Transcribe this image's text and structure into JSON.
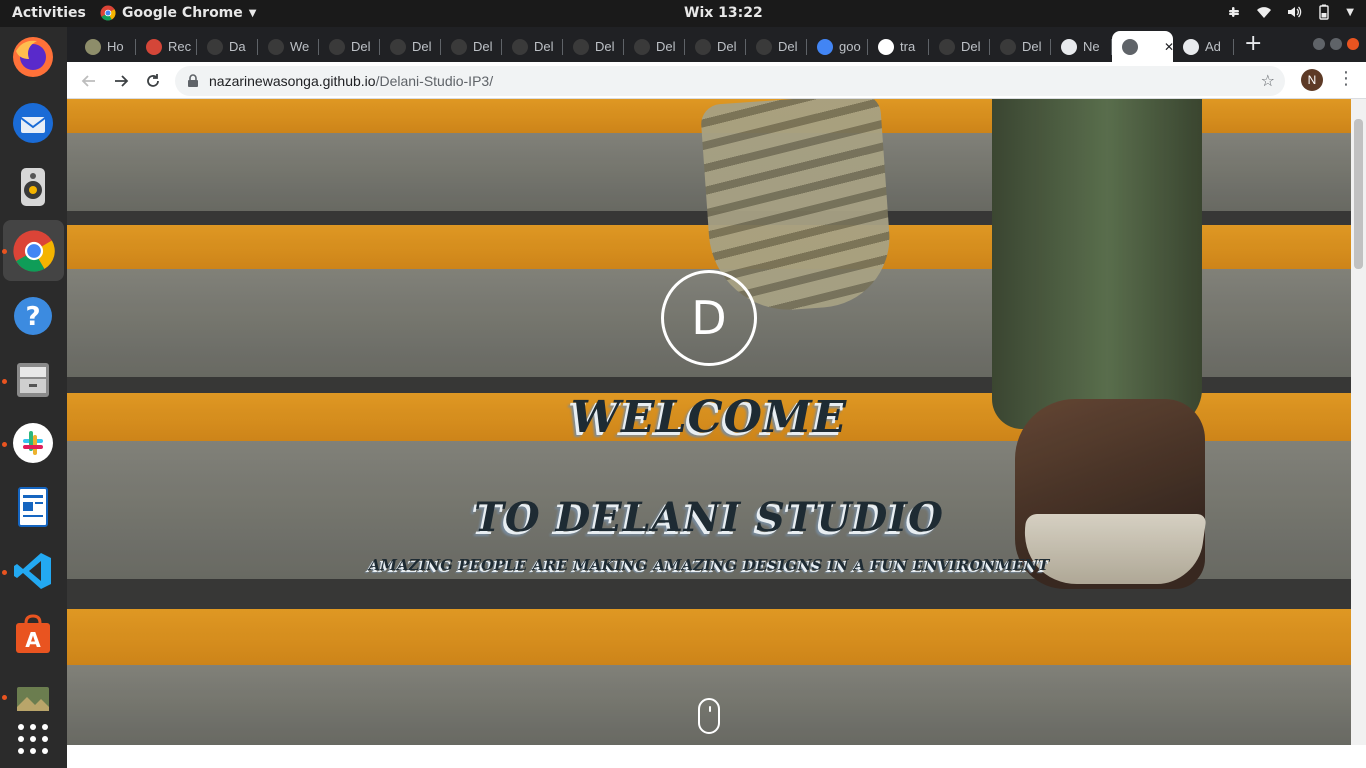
{
  "system": {
    "activities": "Activities",
    "app_menu": "Google Chrome",
    "clock": "Wix 13:22"
  },
  "dock": {
    "items": [
      "firefox-icon",
      "thunderbird-icon",
      "rhythmbox-icon",
      "chrome-icon",
      "help-icon",
      "files-icon",
      "slack-icon",
      "writer-icon",
      "vscode-icon",
      "software-icon",
      "image-viewer-icon",
      "app-grid-icon"
    ]
  },
  "browser": {
    "tabs": [
      {
        "label": "Ho",
        "favicon": "#8d8d6a"
      },
      {
        "label": "Rec",
        "favicon": "#d44638"
      },
      {
        "label": "Da",
        "favicon": "#3a3a3a"
      },
      {
        "label": "We",
        "favicon": "#3a3a3a"
      },
      {
        "label": "Del",
        "favicon": "#3a3a3a"
      },
      {
        "label": "Del",
        "favicon": "#3a3a3a"
      },
      {
        "label": "Del",
        "favicon": "#3a3a3a"
      },
      {
        "label": "Del",
        "favicon": "#3a3a3a"
      },
      {
        "label": "Del",
        "favicon": "#3a3a3a"
      },
      {
        "label": "Del",
        "favicon": "#3a3a3a"
      },
      {
        "label": "Del",
        "favicon": "#3a3a3a"
      },
      {
        "label": "Del",
        "favicon": "#3a3a3a"
      },
      {
        "label": "goo",
        "favicon": "#4285f4"
      },
      {
        "label": "tra",
        "favicon": "#ffffff"
      },
      {
        "label": "Del",
        "favicon": "#3a3a3a"
      },
      {
        "label": "Del",
        "favicon": "#3a3a3a"
      },
      {
        "label": "Ne",
        "favicon": "#e8eaed"
      },
      {
        "label": "",
        "favicon": "#5f6368"
      },
      {
        "label": "Ad",
        "favicon": "#e8eaed"
      }
    ],
    "active_tab_close": "✕",
    "new_tab": "+",
    "url_host": "nazarinewasonga.github.io",
    "url_path": "/Delani-Studio-IP3/",
    "profile_initial": "N"
  },
  "page": {
    "logo_letter": "D",
    "welcome": "WELCOME",
    "studio_title": "TO DELANI STUDIO",
    "tagline": "AMAZING PEOPLE ARE MAKING AMAZING DESIGNS IN A FUN ENVIRONMENT"
  }
}
